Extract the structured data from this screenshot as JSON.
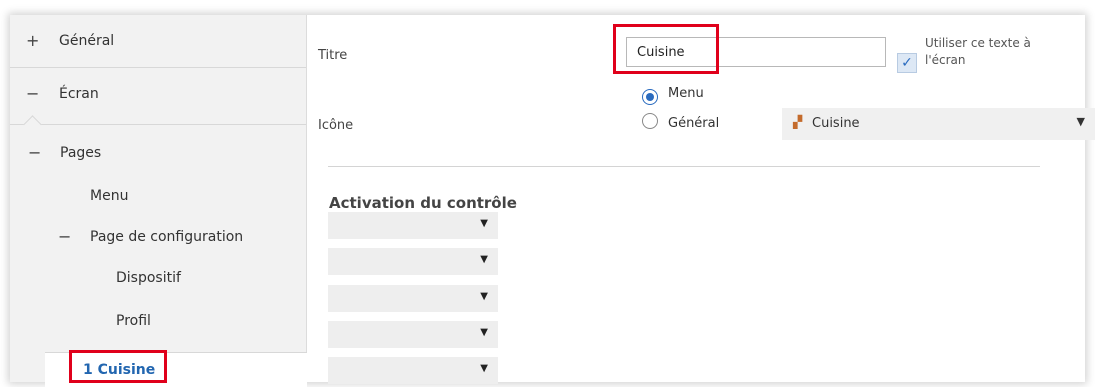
{
  "sidebar": {
    "items": [
      {
        "sign": "+",
        "label": "Général"
      },
      {
        "sign": "−",
        "label": "Écran"
      },
      {
        "sign": "−",
        "label": "Pages"
      },
      {
        "sign": "",
        "label": "Menu"
      },
      {
        "sign": "−",
        "label": "Page de configuration"
      },
      {
        "sign": "",
        "label": "Dispositif"
      },
      {
        "sign": "",
        "label": "Profil"
      },
      {
        "sign": "",
        "label": "1 Cuisine"
      }
    ]
  },
  "main": {
    "title_label": "Titre",
    "title_value": "Cuisine",
    "use_text_label": "Utiliser ce texte à l'écran",
    "use_text_checked": true,
    "icon_label": "Icône",
    "radio_options": [
      "Menu",
      "Général"
    ],
    "radio_selected": "Menu",
    "icon_select_value": "Cuisine",
    "icon_select_icon": "kitchen-icon",
    "section_title": "Activation du contrôle",
    "dropdowns": [
      "",
      "",
      "",
      "",
      ""
    ]
  },
  "colors": {
    "accent": "#2a6bbf",
    "highlight": "#e0001b",
    "selected_text": "#2266b0"
  }
}
